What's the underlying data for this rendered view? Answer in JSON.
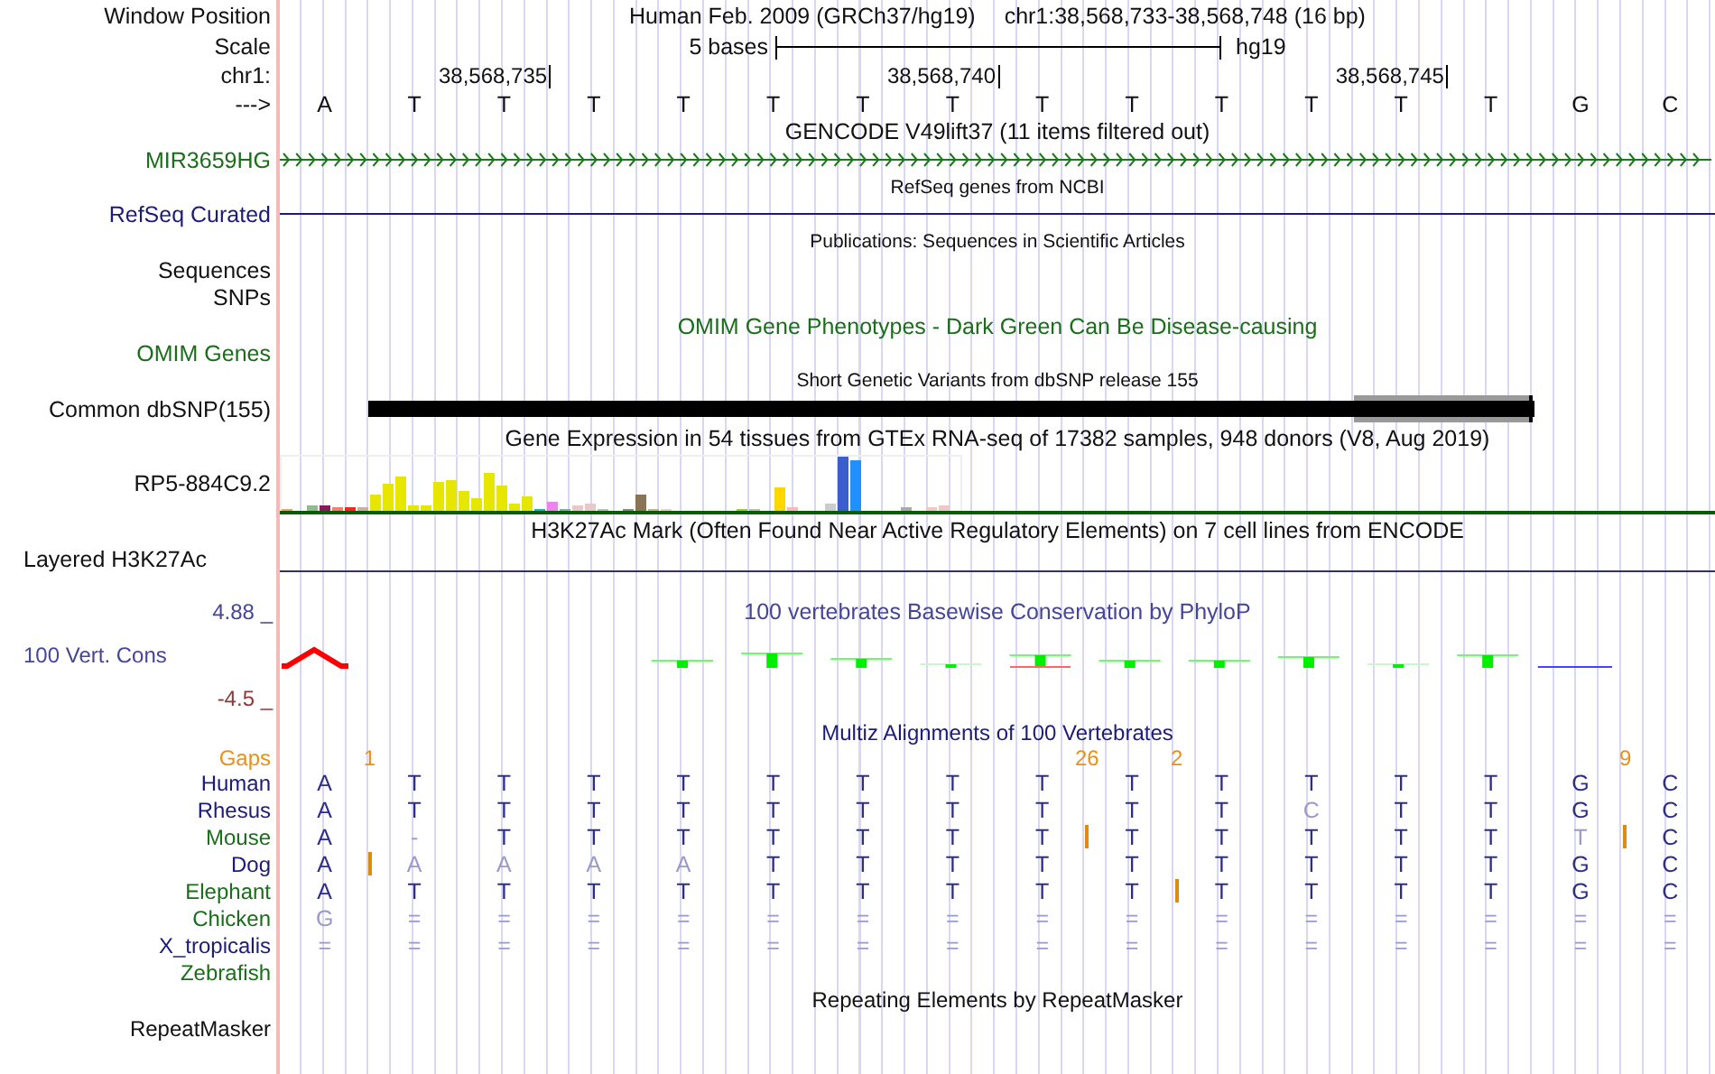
{
  "header": {
    "label": "Window Position",
    "assembly": "Human Feb. 2009 (GRCh37/hg19)",
    "position": "chr1:38,568,733-38,568,748 (16 bp)"
  },
  "scale": {
    "label": "Scale",
    "length": "5 bases",
    "assembly": "hg19"
  },
  "ruler": {
    "label": "chr1:",
    "ticks": [
      "38,568,735",
      "38,568,740",
      "38,568,745"
    ]
  },
  "sequence": {
    "label": "--->",
    "bases": [
      "A",
      "T",
      "T",
      "T",
      "T",
      "T",
      "T",
      "T",
      "T",
      "T",
      "T",
      "T",
      "T",
      "T",
      "G",
      "C"
    ]
  },
  "gencode": {
    "title": "GENCODE V49lift37 (11 items filtered out)",
    "gene": "MIR3659HG"
  },
  "refseq": {
    "title": "RefSeq genes from NCBI",
    "label": "RefSeq Curated"
  },
  "publications": {
    "title": "Publications: Sequences in Scientific Articles",
    "labels": [
      "Sequences",
      "SNPs"
    ]
  },
  "omim": {
    "title": "OMIM Gene Phenotypes - Dark Green Can Be Disease-causing",
    "label": "OMIM Genes"
  },
  "dbsnp": {
    "title": "Short Genetic Variants from dbSNP release 155",
    "label": "Common dbSNP(155)"
  },
  "gtex": {
    "title": "Gene Expression in 54 tissues from GTEx RNA-seq of 17382 samples, 948 donors (V8, Aug 2019)",
    "gene": "RP5-884C9.2"
  },
  "h3k27ac": {
    "title": "H3K27Ac Mark (Often Found Near Active Regulatory Elements) on 7 cell lines from ENCODE",
    "label": "Layered H3K27Ac"
  },
  "phylop": {
    "title": "100 vertebrates Basewise Conservation by PhyloP",
    "label": "100 Vert. Cons",
    "max": "4.88 _",
    "min": "-4.5 _"
  },
  "multiz": {
    "title": "Multiz Alignments of 100 Vertebrates",
    "gaps_label": "Gaps",
    "gaps": [
      {
        "label": "1"
      },
      {
        "label": "26"
      },
      {
        "label": "2"
      },
      {
        "label": "9"
      }
    ],
    "species": [
      {
        "name": "Human",
        "color": "#1c1c78",
        "bases": [
          {
            "text": "A",
            "faint": false,
            "insert": false
          },
          {
            "text": "T",
            "faint": false,
            "insert": false
          },
          {
            "text": "T",
            "faint": false,
            "insert": false
          },
          {
            "text": "T",
            "faint": false,
            "insert": false
          },
          {
            "text": "T",
            "faint": false,
            "insert": false
          },
          {
            "text": "T",
            "faint": false,
            "insert": false
          },
          {
            "text": "T",
            "faint": false,
            "insert": false
          },
          {
            "text": "T",
            "faint": false,
            "insert": false
          },
          {
            "text": "T",
            "faint": false,
            "insert": false
          },
          {
            "text": "T",
            "faint": false,
            "insert": false
          },
          {
            "text": "T",
            "faint": false,
            "insert": false
          },
          {
            "text": "T",
            "faint": false,
            "insert": false
          },
          {
            "text": "T",
            "faint": false,
            "insert": false
          },
          {
            "text": "T",
            "faint": false,
            "insert": false
          },
          {
            "text": "G",
            "faint": false,
            "insert": false
          },
          {
            "text": "C",
            "faint": false,
            "insert": false
          }
        ]
      },
      {
        "name": "Rhesus",
        "color": "#1c1c78",
        "bases": [
          {
            "text": "A",
            "faint": false,
            "insert": false
          },
          {
            "text": "T",
            "faint": false,
            "insert": false
          },
          {
            "text": "T",
            "faint": false,
            "insert": false
          },
          {
            "text": "T",
            "faint": false,
            "insert": false
          },
          {
            "text": "T",
            "faint": false,
            "insert": false
          },
          {
            "text": "T",
            "faint": false,
            "insert": false
          },
          {
            "text": "T",
            "faint": false,
            "insert": false
          },
          {
            "text": "T",
            "faint": false,
            "insert": false
          },
          {
            "text": "T",
            "faint": false,
            "insert": false
          },
          {
            "text": "T",
            "faint": false,
            "insert": false
          },
          {
            "text": "T",
            "faint": false,
            "insert": false
          },
          {
            "text": "C",
            "faint": true,
            "insert": false
          },
          {
            "text": "T",
            "faint": false,
            "insert": false
          },
          {
            "text": "T",
            "faint": false,
            "insert": false
          },
          {
            "text": "G",
            "faint": false,
            "insert": false
          },
          {
            "text": "C",
            "faint": false,
            "insert": false
          }
        ]
      },
      {
        "name": "Mouse",
        "color": "#1a6e1a",
        "bases": [
          {
            "text": "A",
            "faint": false,
            "insert": false
          },
          {
            "text": "-",
            "faint": true,
            "insert": false
          },
          {
            "text": "T",
            "faint": false,
            "insert": false
          },
          {
            "text": "T",
            "faint": false,
            "insert": false
          },
          {
            "text": "T",
            "faint": false,
            "insert": false
          },
          {
            "text": "T",
            "faint": false,
            "insert": false
          },
          {
            "text": "T",
            "faint": false,
            "insert": false
          },
          {
            "text": "T",
            "faint": false,
            "insert": false
          },
          {
            "text": "T",
            "faint": false,
            "insert": true
          },
          {
            "text": "T",
            "faint": false,
            "insert": false
          },
          {
            "text": "T",
            "faint": false,
            "insert": false
          },
          {
            "text": "T",
            "faint": false,
            "insert": false
          },
          {
            "text": "T",
            "faint": false,
            "insert": false
          },
          {
            "text": "T",
            "faint": false,
            "insert": false
          },
          {
            "text": "T",
            "faint": true,
            "insert": true
          },
          {
            "text": "C",
            "faint": false,
            "insert": false
          }
        ]
      },
      {
        "name": "Dog",
        "color": "#1c1c78",
        "bases": [
          {
            "text": "A",
            "faint": false,
            "insert": true
          },
          {
            "text": "A",
            "faint": true,
            "insert": false
          },
          {
            "text": "A",
            "faint": true,
            "insert": false
          },
          {
            "text": "A",
            "faint": true,
            "insert": false
          },
          {
            "text": "A",
            "faint": true,
            "insert": false
          },
          {
            "text": "T",
            "faint": false,
            "insert": false
          },
          {
            "text": "T",
            "faint": false,
            "insert": false
          },
          {
            "text": "T",
            "faint": false,
            "insert": false
          },
          {
            "text": "T",
            "faint": false,
            "insert": false
          },
          {
            "text": "T",
            "faint": false,
            "insert": false
          },
          {
            "text": "T",
            "faint": false,
            "insert": false
          },
          {
            "text": "T",
            "faint": false,
            "insert": false
          },
          {
            "text": "T",
            "faint": false,
            "insert": false
          },
          {
            "text": "T",
            "faint": false,
            "insert": false
          },
          {
            "text": "G",
            "faint": false,
            "insert": false
          },
          {
            "text": "C",
            "faint": false,
            "insert": false
          }
        ]
      },
      {
        "name": "Elephant",
        "color": "#1a6e1a",
        "bases": [
          {
            "text": "A",
            "faint": false,
            "insert": false
          },
          {
            "text": "T",
            "faint": false,
            "insert": false
          },
          {
            "text": "T",
            "faint": false,
            "insert": false
          },
          {
            "text": "T",
            "faint": false,
            "insert": false
          },
          {
            "text": "T",
            "faint": false,
            "insert": false
          },
          {
            "text": "T",
            "faint": false,
            "insert": false
          },
          {
            "text": "T",
            "faint": false,
            "insert": false
          },
          {
            "text": "T",
            "faint": false,
            "insert": false
          },
          {
            "text": "T",
            "faint": false,
            "insert": false
          },
          {
            "text": "T",
            "faint": false,
            "insert": true
          },
          {
            "text": "T",
            "faint": false,
            "insert": false
          },
          {
            "text": "T",
            "faint": false,
            "insert": false
          },
          {
            "text": "T",
            "faint": false,
            "insert": false
          },
          {
            "text": "T",
            "faint": false,
            "insert": false
          },
          {
            "text": "G",
            "faint": false,
            "insert": false
          },
          {
            "text": "C",
            "faint": false,
            "insert": false
          }
        ]
      },
      {
        "name": "Chicken",
        "color": "#1a6e1a",
        "bases": [
          {
            "text": "G",
            "faint": true,
            "insert": false
          },
          {
            "text": "=",
            "faint": true,
            "insert": false
          },
          {
            "text": "=",
            "faint": true,
            "insert": false
          },
          {
            "text": "=",
            "faint": true,
            "insert": false
          },
          {
            "text": "=",
            "faint": true,
            "insert": false
          },
          {
            "text": "=",
            "faint": true,
            "insert": false
          },
          {
            "text": "=",
            "faint": true,
            "insert": false
          },
          {
            "text": "=",
            "faint": true,
            "insert": false
          },
          {
            "text": "=",
            "faint": true,
            "insert": false
          },
          {
            "text": "=",
            "faint": true,
            "insert": false
          },
          {
            "text": "=",
            "faint": true,
            "insert": false
          },
          {
            "text": "=",
            "faint": true,
            "insert": false
          },
          {
            "text": "=",
            "faint": true,
            "insert": false
          },
          {
            "text": "=",
            "faint": true,
            "insert": false
          },
          {
            "text": "=",
            "faint": true,
            "insert": false
          },
          {
            "text": "=",
            "faint": true,
            "insert": false
          }
        ]
      },
      {
        "name": "X_tropicalis",
        "color": "#1c1c78",
        "bases": [
          {
            "text": "=",
            "faint": true,
            "insert": false
          },
          {
            "text": "=",
            "faint": true,
            "insert": false
          },
          {
            "text": "=",
            "faint": true,
            "insert": false
          },
          {
            "text": "=",
            "faint": true,
            "insert": false
          },
          {
            "text": "=",
            "faint": true,
            "insert": false
          },
          {
            "text": "=",
            "faint": true,
            "insert": false
          },
          {
            "text": "=",
            "faint": true,
            "insert": false
          },
          {
            "text": "=",
            "faint": true,
            "insert": false
          },
          {
            "text": "=",
            "faint": true,
            "insert": false
          },
          {
            "text": "=",
            "faint": true,
            "insert": false
          },
          {
            "text": "=",
            "faint": true,
            "insert": false
          },
          {
            "text": "=",
            "faint": true,
            "insert": false
          },
          {
            "text": "=",
            "faint": true,
            "insert": false
          },
          {
            "text": "=",
            "faint": true,
            "insert": false
          },
          {
            "text": "=",
            "faint": true,
            "insert": false
          },
          {
            "text": "=",
            "faint": true,
            "insert": false
          }
        ]
      },
      {
        "name": "Zebrafish",
        "color": "#1a6e1a"
      }
    ]
  },
  "repeatmasker": {
    "title": "Repeating Elements by RepeatMasker",
    "label": "RepeatMasker"
  }
}
